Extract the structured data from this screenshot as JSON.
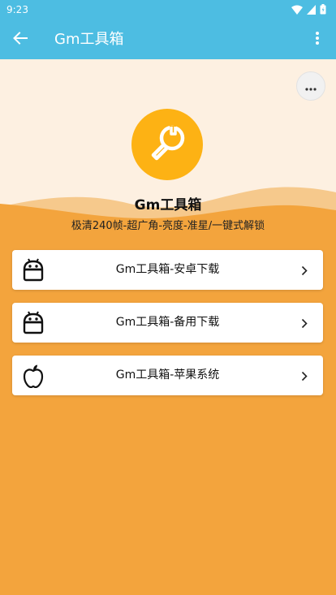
{
  "status_bar": {
    "time": "9:23",
    "icons": [
      "wifi-icon",
      "signal-icon",
      "battery-icon"
    ]
  },
  "app_bar": {
    "title": "Gm工具箱",
    "back_icon": "back-arrow-icon",
    "menu_icon": "more-vert-icon"
  },
  "header": {
    "more_icon": "more-horiz-icon",
    "logo_icon": "wrench-icon",
    "title": "Gm工具箱",
    "subtitle": "极清240帧-超广角-亮度-准星/一键式解锁"
  },
  "cards": [
    {
      "icon": "android-icon",
      "label": "Gm工具箱-安卓下载"
    },
    {
      "icon": "android-icon",
      "label": "Gm工具箱-备用下载"
    },
    {
      "icon": "apple-icon",
      "label": "Gm工具箱-苹果系统"
    }
  ],
  "colors": {
    "app_bar": "#4DBDE2",
    "background": "#F3A43D",
    "header_light": "#FDF0E1",
    "logo": "#FDB214",
    "card": "#FFFFFF"
  }
}
